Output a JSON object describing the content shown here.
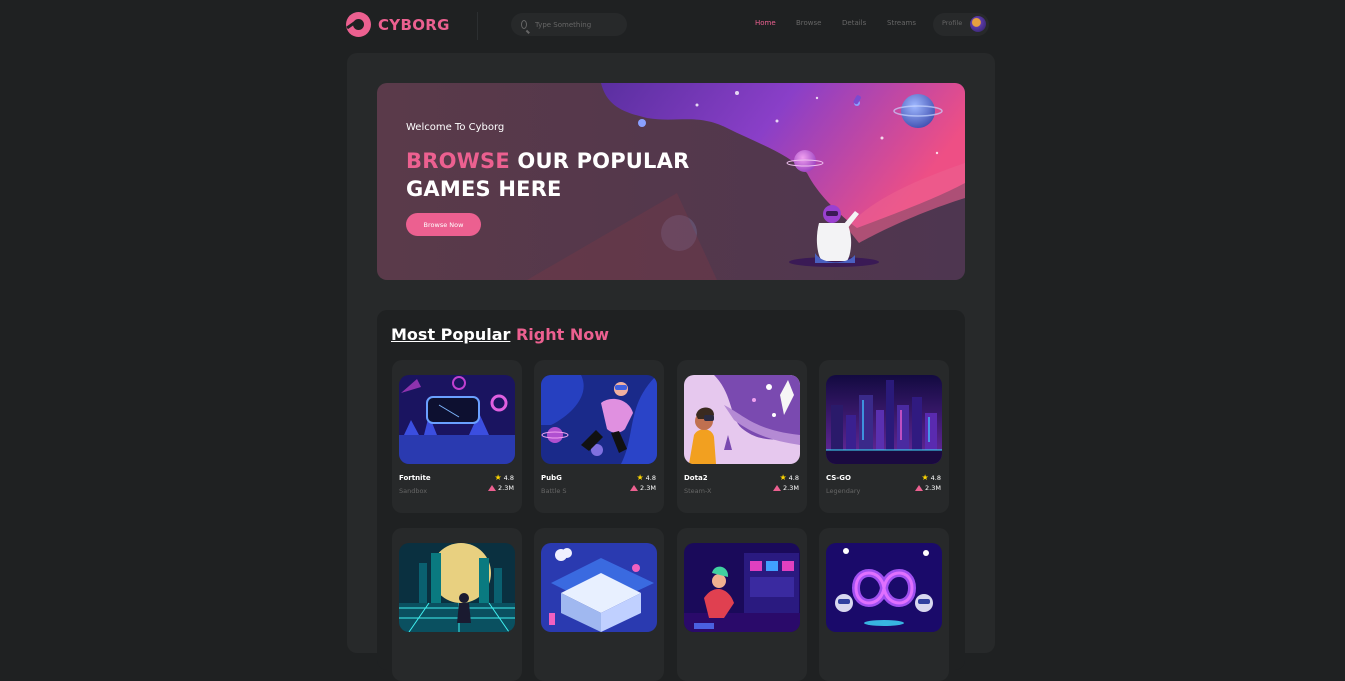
{
  "brand": {
    "name": "CYBORG"
  },
  "search": {
    "placeholder": "Type Something"
  },
  "nav": [
    {
      "label": "Home",
      "active": true
    },
    {
      "label": "Browse",
      "active": false
    },
    {
      "label": "Details",
      "active": false
    },
    {
      "label": "Streams",
      "active": false
    }
  ],
  "profile": {
    "label": "Profile"
  },
  "banner": {
    "welcome": "Welcome To Cyborg",
    "headline_accent": "BROWSE",
    "headline_line1_rest": " OUR POPULAR",
    "headline_line2": "GAMES HERE",
    "button_label": "Browse Now"
  },
  "popular": {
    "title_main": "Most Popular",
    "title_accent": "Right Now",
    "games": [
      {
        "name": "Fortnite",
        "category": "Sandbox",
        "rating": "4.8",
        "downloads": "2.3M",
        "icon": "vr-headset-art"
      },
      {
        "name": "PubG",
        "category": "Battle S",
        "rating": "4.8",
        "downloads": "2.3M",
        "icon": "floating-gamer-art"
      },
      {
        "name": "Dota2",
        "category": "Steam-X",
        "rating": "4.8",
        "downloads": "2.3M",
        "icon": "vr-space-art"
      },
      {
        "name": "CS-GO",
        "category": "Legendary",
        "rating": "4.8",
        "downloads": "2.3M",
        "icon": "neon-city-art"
      }
    ],
    "second_row_icons": [
      "neon-skater-art",
      "vr-isometric-art",
      "cyber-room-art",
      "infinity-robots-art"
    ]
  },
  "colors": {
    "accent": "#ec6090",
    "background": "#1f2122",
    "panel": "#27292a",
    "muted": "#666666"
  }
}
